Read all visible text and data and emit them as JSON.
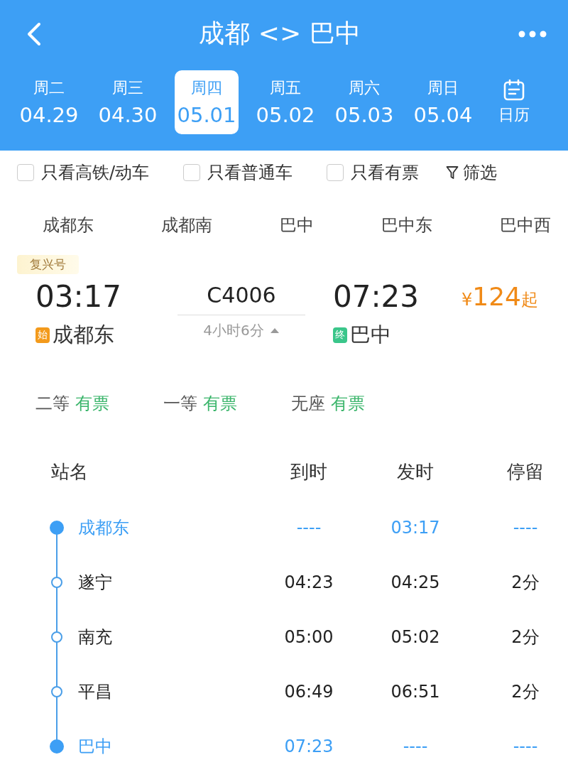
{
  "header": {
    "title": "成都 <> 巴中"
  },
  "dates": [
    {
      "weekday": "周二",
      "date": "04.29",
      "selected": false
    },
    {
      "weekday": "周三",
      "date": "04.30",
      "selected": false
    },
    {
      "weekday": "周四",
      "date": "05.01",
      "selected": true
    },
    {
      "weekday": "周五",
      "date": "05.02",
      "selected": false
    },
    {
      "weekday": "周六",
      "date": "05.03",
      "selected": false
    },
    {
      "weekday": "周日",
      "date": "05.04",
      "selected": false
    }
  ],
  "calendar": {
    "label": "日历"
  },
  "filters": [
    {
      "label": "只看高铁/动车",
      "checked": false
    },
    {
      "label": "只看普通车",
      "checked": false
    },
    {
      "label": "只看有票",
      "checked": false
    }
  ],
  "filter_button": {
    "label": "筛选"
  },
  "stations": [
    "成都东",
    "成都南",
    "巴中",
    "巴中东",
    "巴中西"
  ],
  "train": {
    "badge": "复兴号",
    "depart_time": "03:17",
    "number": "C4006",
    "arrive_time": "07:23",
    "currency": "¥",
    "price": "124",
    "price_suffix": "起",
    "depart_tag": "始",
    "depart_station": "成都东",
    "duration": "4小时6分",
    "expanded": true,
    "arrive_tag": "终",
    "arrive_station": "巴中",
    "seats": [
      {
        "class": "二等",
        "availability": "有票"
      },
      {
        "class": "一等",
        "availability": "有票"
      },
      {
        "class": "无座",
        "availability": "有票"
      }
    ]
  },
  "stops": {
    "columns": [
      "站名",
      "到时",
      "发时",
      "停留"
    ],
    "rows": [
      {
        "kind": "terminal",
        "name": "成都东",
        "arrive": "----",
        "depart": "03:17",
        "stay": "----"
      },
      {
        "kind": "intermediate",
        "name": "遂宁",
        "arrive": "04:23",
        "depart": "04:25",
        "stay": "2分"
      },
      {
        "kind": "intermediate",
        "name": "南充",
        "arrive": "05:00",
        "depart": "05:02",
        "stay": "2分"
      },
      {
        "kind": "intermediate",
        "name": "平昌",
        "arrive": "06:49",
        "depart": "06:51",
        "stay": "2分"
      },
      {
        "kind": "terminal",
        "name": "巴中",
        "arrive": "07:23",
        "depart": "----",
        "stay": "----"
      }
    ]
  }
}
